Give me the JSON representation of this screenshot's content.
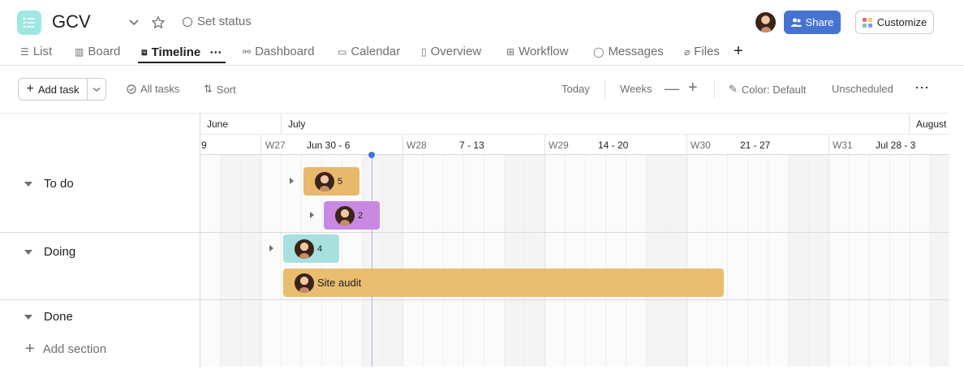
{
  "project": {
    "title": "GCV",
    "set_status": "Set status"
  },
  "header": {
    "share_label": "Share",
    "customize_label": "Customize"
  },
  "tabs": [
    {
      "label": "List",
      "icon": "list-icon"
    },
    {
      "label": "Board",
      "icon": "board-icon"
    },
    {
      "label": "Timeline",
      "icon": "timeline-icon",
      "active": true
    },
    {
      "label": "Dashboard",
      "icon": "dashboard-icon"
    },
    {
      "label": "Calendar",
      "icon": "calendar-icon"
    },
    {
      "label": "Overview",
      "icon": "overview-icon"
    },
    {
      "label": "Workflow",
      "icon": "workflow-icon"
    },
    {
      "label": "Messages",
      "icon": "messages-icon"
    },
    {
      "label": "Files",
      "icon": "files-icon"
    }
  ],
  "toolbar": {
    "add_task": "Add task",
    "all_tasks": "All tasks",
    "sort": "Sort",
    "today": "Today",
    "zoom": "Weeks",
    "color": "Color: Default",
    "unscheduled": "Unscheduled"
  },
  "timeline": {
    "months": [
      "June",
      "July",
      "August"
    ],
    "weeks": [
      {
        "label": "",
        "range": "9"
      },
      {
        "label": "W27",
        "range": "Jun 30 - 6"
      },
      {
        "label": "W28",
        "range": "7 - 13"
      },
      {
        "label": "W29",
        "range": "14 - 20"
      },
      {
        "label": "W30",
        "range": "21 - 27"
      },
      {
        "label": "W31",
        "range": "Jul 28 - 3"
      }
    ],
    "sections": [
      {
        "name": "To do"
      },
      {
        "name": "Doing"
      },
      {
        "name": "Done"
      }
    ],
    "add_section": "Add section",
    "bars": [
      {
        "section": "To do",
        "label": "5",
        "color": "#e8b86d",
        "is_group": true
      },
      {
        "section": "To do",
        "label": "2",
        "color": "#c989e2",
        "is_group": true
      },
      {
        "section": "Doing",
        "label": "4",
        "color": "#a8e0df",
        "is_group": true
      },
      {
        "section": "Doing",
        "label": "Site audit",
        "color": "#e9bd70",
        "is_group": false
      }
    ]
  },
  "colors": {
    "accent": "#4573d2",
    "today_marker": "#4573d2"
  }
}
